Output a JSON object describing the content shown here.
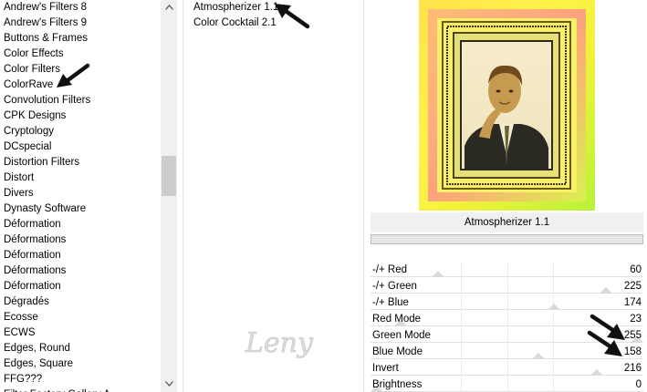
{
  "filter_list": {
    "items": [
      "Andrew's Filters 8",
      "Andrew's Filters 9",
      "Buttons & Frames",
      "Color Effects",
      "Color Filters",
      "ColorRave",
      "Convolution Filters",
      "CPK Designs",
      "Cryptology",
      "DCspecial",
      "Distortion Filters",
      "Distort",
      "Divers",
      "Dynasty Software",
      "Déformation",
      "Déformations",
      "Déformation",
      "Déformations",
      "Déformation",
      "Dégradés",
      "Ecosse",
      "ECWS",
      "Edges, Round",
      "Edges, Square",
      "FFG???",
      "Filter Factory Gallery A"
    ],
    "scroll_up_icon": "triangle-up-icon",
    "scroll_down_icon": "triangle-down-icon"
  },
  "effects_list": {
    "items": [
      "Atmospherizer 1.1",
      "Color Cocktail 2.1"
    ]
  },
  "watermark_text": "Leny",
  "filter_panel": {
    "title": "Atmospherizer 1.1",
    "params": [
      {
        "name": "-/+ Red",
        "value": "60",
        "level": 60
      },
      {
        "name": "-/+ Green",
        "value": "225",
        "level": 225
      },
      {
        "name": "-/+ Blue",
        "value": "174",
        "level": 174
      },
      {
        "name": "Red Mode",
        "value": "23",
        "level": 23
      },
      {
        "name": "Green Mode",
        "value": "255",
        "level": 255
      },
      {
        "name": "Blue Mode",
        "value": "158",
        "level": 158
      },
      {
        "name": "Invert",
        "value": "216",
        "level": 216
      },
      {
        "name": "Brightness",
        "value": "0",
        "level": 0
      }
    ],
    "slider_max": 255
  },
  "colors": {
    "arrow": "#111111",
    "preview_yellow": "#f7ea2a",
    "preview_pink": "#ff5fa8",
    "preview_green": "#a8ef2e"
  }
}
